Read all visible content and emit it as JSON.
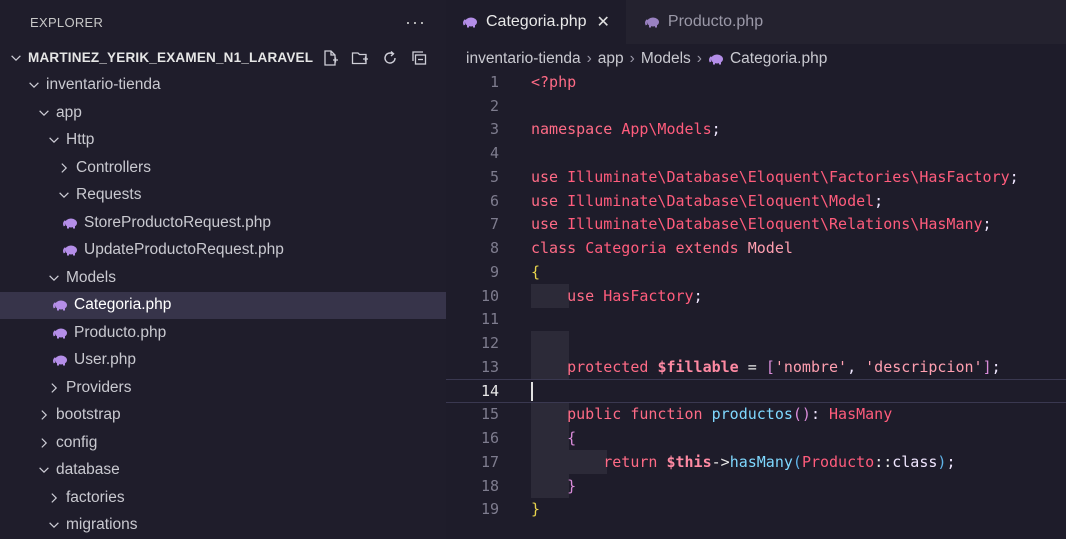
{
  "explorer": {
    "title": "EXPLORER",
    "more": "···",
    "root": "MARTINEZ_YERIK_EXAMEN_N1_LARAVEL",
    "items": [
      {
        "label": "inventario-tienda",
        "type": "folder",
        "open": true,
        "depth": 1
      },
      {
        "label": "app",
        "type": "folder",
        "open": true,
        "depth": 2
      },
      {
        "label": "Http",
        "type": "folder",
        "open": true,
        "depth": 3
      },
      {
        "label": "Controllers",
        "type": "folder",
        "open": false,
        "depth": 4
      },
      {
        "label": "Requests",
        "type": "folder",
        "open": true,
        "depth": 4
      },
      {
        "label": "StoreProductoRequest.php",
        "type": "php",
        "depth": 5
      },
      {
        "label": "UpdateProductoRequest.php",
        "type": "php",
        "depth": 5
      },
      {
        "label": "Models",
        "type": "folder",
        "open": true,
        "depth": 3
      },
      {
        "label": "Categoria.php",
        "type": "php",
        "depth": 4,
        "selected": true
      },
      {
        "label": "Producto.php",
        "type": "php",
        "depth": 4
      },
      {
        "label": "User.php",
        "type": "php",
        "depth": 4
      },
      {
        "label": "Providers",
        "type": "folder",
        "open": false,
        "depth": 3
      },
      {
        "label": "bootstrap",
        "type": "folder",
        "open": false,
        "depth": 2
      },
      {
        "label": "config",
        "type": "folder",
        "open": false,
        "depth": 2
      },
      {
        "label": "database",
        "type": "folder",
        "open": true,
        "depth": 2
      },
      {
        "label": "factories",
        "type": "folder",
        "open": false,
        "depth": 3
      },
      {
        "label": "migrations",
        "type": "folder",
        "open": true,
        "depth": 3
      }
    ]
  },
  "tabs": [
    {
      "label": "Categoria.php",
      "active": true,
      "close": "✕"
    },
    {
      "label": "Producto.php",
      "active": false
    }
  ],
  "breadcrumb": [
    "inventario-tienda",
    "app",
    "Models",
    "Categoria.php"
  ],
  "editor": {
    "current_line": 14,
    "lines": [
      {
        "n": "1",
        "text": "<?php"
      },
      {
        "n": "2",
        "text": ""
      },
      {
        "n": "3",
        "text": "namespace App\\Models;"
      },
      {
        "n": "4",
        "text": ""
      },
      {
        "n": "5",
        "text": "use Illuminate\\Database\\Eloquent\\Factories\\HasFactory;"
      },
      {
        "n": "6",
        "text": "use Illuminate\\Database\\Eloquent\\Model;"
      },
      {
        "n": "7",
        "text": "use Illuminate\\Database\\Eloquent\\Relations\\HasMany;"
      },
      {
        "n": "8",
        "text": "class Categoria extends Model"
      },
      {
        "n": "9",
        "text": "{"
      },
      {
        "n": "10",
        "text": "    use HasFactory;"
      },
      {
        "n": "11",
        "text": ""
      },
      {
        "n": "12",
        "text": ""
      },
      {
        "n": "13",
        "text": "    protected $fillable = ['nombre', 'descripcion'];"
      },
      {
        "n": "14",
        "text": ""
      },
      {
        "n": "15",
        "text": "    public function productos(): HasMany"
      },
      {
        "n": "16",
        "text": "    {"
      },
      {
        "n": "17",
        "text": "        return $this->hasMany(Producto::class);"
      },
      {
        "n": "18",
        "text": "    }"
      },
      {
        "n": "19",
        "text": "}"
      }
    ]
  },
  "colors": {
    "sidebar_bg": "#1f1d2b",
    "editor_bg": "#1e1c2a",
    "selected_row": "#37344a",
    "php_icon": "#b48ee8"
  }
}
